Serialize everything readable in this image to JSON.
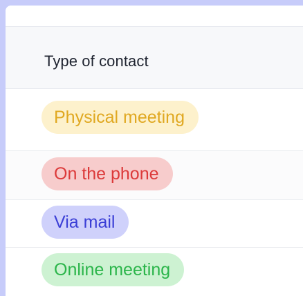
{
  "table": {
    "column_header": "Type of contact",
    "rows": [
      {
        "label": "Physical meeting",
        "color_bg": "#fdf1cc",
        "color_text": "#e0a821"
      },
      {
        "label": "On the phone",
        "color_bg": "#f7cccc",
        "color_text": "#dc3a3a"
      },
      {
        "label": "Via mail",
        "color_bg": "#cfd1fb",
        "color_text": "#3b3fd6"
      },
      {
        "label": "Online meeting",
        "color_bg": "#cdf2d2",
        "color_text": "#2bb54a"
      }
    ]
  }
}
